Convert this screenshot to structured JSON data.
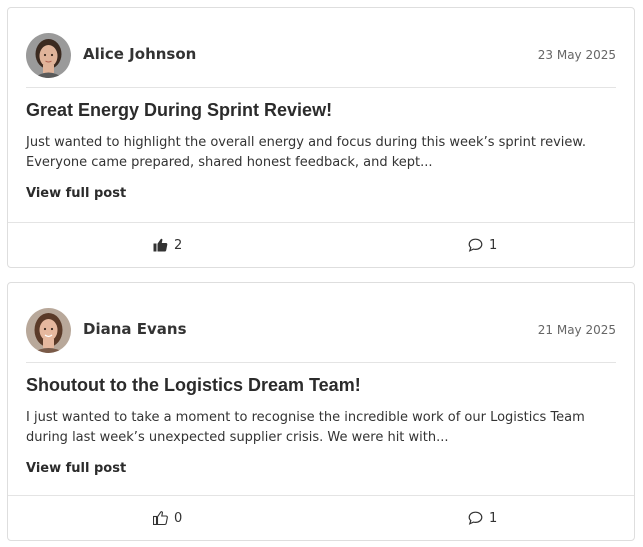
{
  "posts": [
    {
      "author": "Alice Johnson",
      "date": "23 May 2025",
      "title": "Great Energy During Sprint Review!",
      "excerpt_line1": "Just wanted to highlight the overall energy and focus during this week’s sprint review.",
      "excerpt_line2": "Everyone came prepared, shared honest feedback, and kept...",
      "view_label": "View full post",
      "likes": "2",
      "liked": true,
      "comments": "1",
      "avatar": {
        "skin": "#e0b49a",
        "hair": "#3b2a20",
        "bg": "#9a9a9a"
      }
    },
    {
      "author": "Diana Evans",
      "date": "21 May 2025",
      "title": "Shoutout to the Logistics Dream Team!",
      "excerpt_line1": "I just wanted to take a moment to recognise the incredible work of our Logistics Team",
      "excerpt_line2": "during last week’s unexpected supplier crisis. We were hit with...",
      "view_label": "View full post",
      "likes": "0",
      "liked": false,
      "comments": "1",
      "avatar": {
        "skin": "#e6b89e",
        "hair": "#5a3a28",
        "bg": "#b8a89a"
      }
    }
  ],
  "icons": {
    "like": "thumbs-up-icon",
    "comment": "comment-icon"
  },
  "colors": {
    "text": "#333333",
    "muted": "#666666",
    "border": "#dedede"
  }
}
